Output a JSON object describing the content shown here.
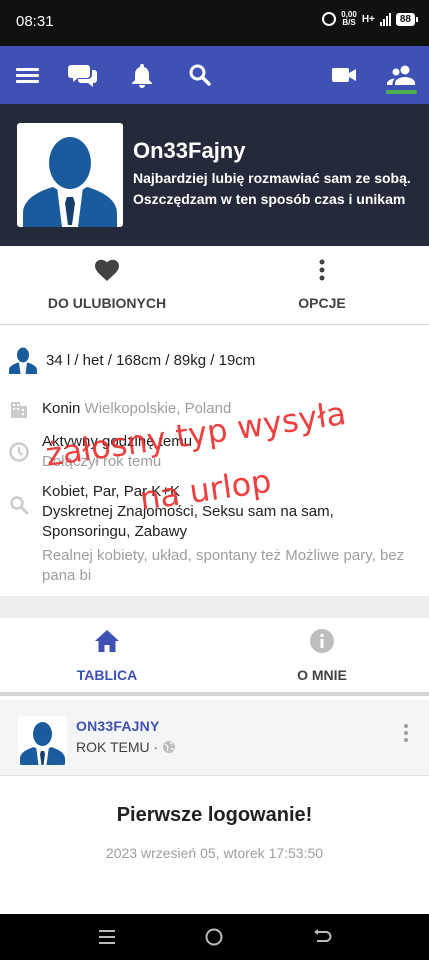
{
  "status_bar": {
    "time": "08:31",
    "net_speed_value": "0,00",
    "net_speed_unit": "B/S",
    "network_type": "H+",
    "battery": "88"
  },
  "app_bar": {
    "icons": [
      "menu-icon",
      "chat-icon",
      "bell-icon",
      "search-icon",
      "video-icon",
      "people-icon"
    ],
    "active_indicator_color": "#4caf50",
    "background_color": "#3f51b5"
  },
  "profile": {
    "username": "On33Fajny",
    "bio": "Najbardziej lubię rozmawiać sam ze sobą. Oszczędzam w ten sposób czas i unikam"
  },
  "actions": {
    "favorite_label": "DO ULUBIONYCH",
    "options_label": "OPCJE"
  },
  "details": {
    "stats": "34 l / het / 168cm / 89kg / 19cm",
    "city": "Konin",
    "region": "Wielkopolskie, Poland",
    "activity": "Aktywny godzinę temu",
    "joined": "Dołączył rok temu",
    "looking_for": "Kobiet, Par, Par K+K",
    "interests": "Dyskretnej Znajomości, Seksu sam na sam, Sponsoringu, Zabawy",
    "description": "Realnej kobiety, układ, spontany też Możliwe pary, bez pana bi"
  },
  "overlay": {
    "line1": "żałosny typ wysyła",
    "line2": "na urlop",
    "color": "#ee2b2b"
  },
  "tabs": [
    {
      "label": "TABLICA",
      "active": true
    },
    {
      "label": "O MNIE",
      "active": false
    }
  ],
  "post": {
    "author": "ON33FAJNY",
    "time": "ROK TEMU ·",
    "title": "Pierwsze logowanie!",
    "date": "2023 wrzesień 05, wtorek 17:53:50"
  },
  "colors": {
    "primary": "#3f51b5",
    "header_dark": "#252a3a",
    "muted_text": "#9e9e9e"
  }
}
